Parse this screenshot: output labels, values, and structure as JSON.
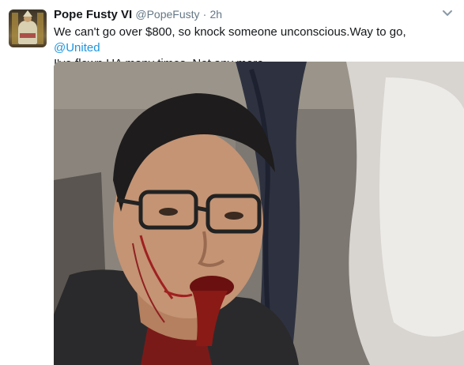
{
  "tweet": {
    "display_name": "Pope Fusty VI",
    "handle": "@PopeFusty",
    "separator": "·",
    "timestamp": "2h",
    "text_part1": "We can't go over $800, so knock someone unconscious.Way to go, ",
    "mention": "@United",
    "text_part2": "I've flown UA many times. Not any more."
  },
  "icons": {
    "menu": "chevron-down-icon"
  },
  "colors": {
    "text": "#14171a",
    "secondary": "#657786",
    "link": "#1b95e0"
  }
}
